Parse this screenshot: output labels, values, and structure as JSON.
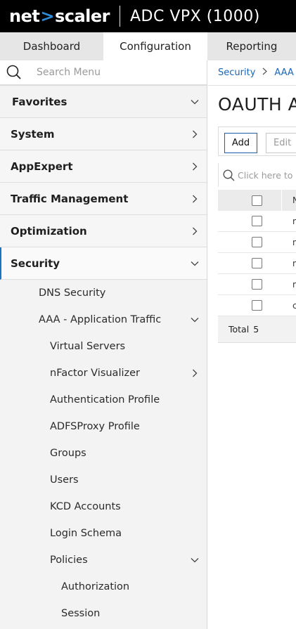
{
  "header": {
    "brand_left": "net",
    "brand_mark": ">",
    "brand_right": "scaler",
    "product": "ADC VPX (1000)"
  },
  "tabs": [
    {
      "label": "Dashboard",
      "active": false
    },
    {
      "label": "Configuration",
      "active": true
    },
    {
      "label": "Reporting",
      "active": false
    }
  ],
  "sidebar": {
    "search_placeholder": "Search Menu",
    "favorites": "Favorites",
    "top_items": [
      "System",
      "AppExpert",
      "Traffic Management",
      "Optimization"
    ],
    "security": "Security",
    "security_children": {
      "dns": "DNS Security",
      "aaa": "AAA - Application Traffic",
      "aaa_children": [
        "Virtual Servers",
        "nFactor Visualizer",
        "Authentication Profile",
        "ADFSProxy Profile",
        "Groups",
        "Users",
        "KCD Accounts",
        "Login Schema",
        "Policies"
      ],
      "policies_children": [
        "Authorization",
        "Session"
      ]
    }
  },
  "main": {
    "breadcrumb": [
      "Security",
      "AAA"
    ],
    "title": "OAUTH A",
    "add_label": "Add",
    "edit_label": "Edit",
    "table_search_placeholder": "Click here to se",
    "header_col2": "N",
    "rows": [
      "n",
      "n",
      "n",
      "n",
      "c"
    ],
    "total_label": "Total",
    "total_count": "5"
  },
  "colors": {
    "topbar": "#000000",
    "brand_mark": "#2e8cd6",
    "link": "#1a66b8",
    "active_border": "#1a73c7"
  }
}
